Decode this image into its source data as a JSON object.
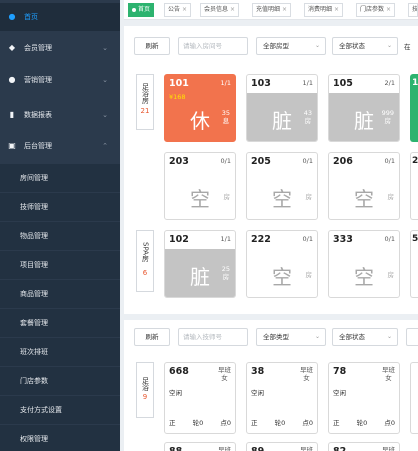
{
  "sidebar": {
    "home": {
      "label": "首页",
      "icon": "dot-icon"
    },
    "menus": [
      {
        "label": "会员管理",
        "icon": "member-icon",
        "chevron": "⌄"
      },
      {
        "label": "营销管理",
        "icon": "marketing-icon",
        "chevron": "⌄"
      },
      {
        "label": "数据报表",
        "icon": "chart-icon",
        "chevron": "⌄"
      },
      {
        "label": "后台管理",
        "icon": "admin-icon",
        "chevron": "⌃"
      }
    ],
    "submenu": [
      "房间管理",
      "技师管理",
      "物品管理",
      "项目管理",
      "商品管理",
      "套餐管理",
      "班次排班",
      "门店参数",
      "支付方式设置",
      "权限管理"
    ]
  },
  "tabs": [
    {
      "label": "首页",
      "active": true
    },
    {
      "label": "公告",
      "close": "×"
    },
    {
      "label": "会员信息",
      "close": "×"
    },
    {
      "label": "充值明细",
      "close": "×"
    },
    {
      "label": "消费明细",
      "close": "×"
    },
    {
      "label": "门店参数",
      "close": "×"
    },
    {
      "label": "技"
    }
  ],
  "rooms_panel": {
    "refresh": "刷新",
    "search_placeholder": "请输入房间号",
    "type_select": "全部房型",
    "status_select": "全部状态",
    "extra_label": "在",
    "caret": "⌄",
    "groups": [
      {
        "name": "足浴房",
        "count": "21"
      },
      {
        "name": "SPA房",
        "count": "6"
      }
    ],
    "row1": [
      {
        "num": "101",
        "cap": "1/1",
        "price": "¥168",
        "status": "休",
        "side": "35",
        "unit": "息"
      },
      {
        "num": "103",
        "cap": "1/1",
        "status": "脏",
        "side": "43",
        "unit": "房"
      },
      {
        "num": "105",
        "cap": "2/1",
        "status": "脏",
        "side": "999",
        "unit": "房"
      }
    ],
    "row2": [
      {
        "num": "203",
        "cap": "0/1",
        "status": "空",
        "unit": "房"
      },
      {
        "num": "205",
        "cap": "0/1",
        "status": "空",
        "unit": "房"
      },
      {
        "num": "206",
        "cap": "0/1",
        "status": "空",
        "unit": "房"
      }
    ],
    "row3": [
      {
        "num": "102",
        "cap": "1/1",
        "status": "脏",
        "side": "25",
        "unit": "房"
      },
      {
        "num": "222",
        "cap": "0/1",
        "status": "空",
        "unit": "房"
      },
      {
        "num": "333",
        "cap": "0/1",
        "status": "空",
        "unit": "房"
      }
    ],
    "edge_nums": [
      "1",
      "2",
      "5"
    ]
  },
  "tech_panel": {
    "refresh": "刷新",
    "search_placeholder": "请输入技师号",
    "type_select": "全部类型",
    "status_select": "全部状态",
    "group": {
      "name": "足浴",
      "count": "9"
    },
    "cards": [
      {
        "num": "668",
        "shift": "早班",
        "gender": "女",
        "status": "空闲",
        "f1": "正",
        "f2": "轮0",
        "f3": "点0"
      },
      {
        "num": "38",
        "shift": "早班",
        "gender": "女",
        "status": "空闲",
        "f1": "正",
        "f2": "轮0",
        "f3": "点0"
      },
      {
        "num": "78",
        "shift": "早班",
        "gender": "女",
        "status": "空闲",
        "f1": "正",
        "f2": "轮0",
        "f3": "点0"
      }
    ],
    "next_row": [
      {
        "num": "88",
        "shift": "早班"
      },
      {
        "num": "89",
        "shift": "早班"
      },
      {
        "num": "82",
        "shift": "早班"
      }
    ]
  },
  "colors": {
    "sidebar": "#2b3a4c",
    "accent": "#1e9fff",
    "rest": "#f2734d",
    "dirty": "#c4c4c4",
    "active_tab": "#2db36f"
  }
}
